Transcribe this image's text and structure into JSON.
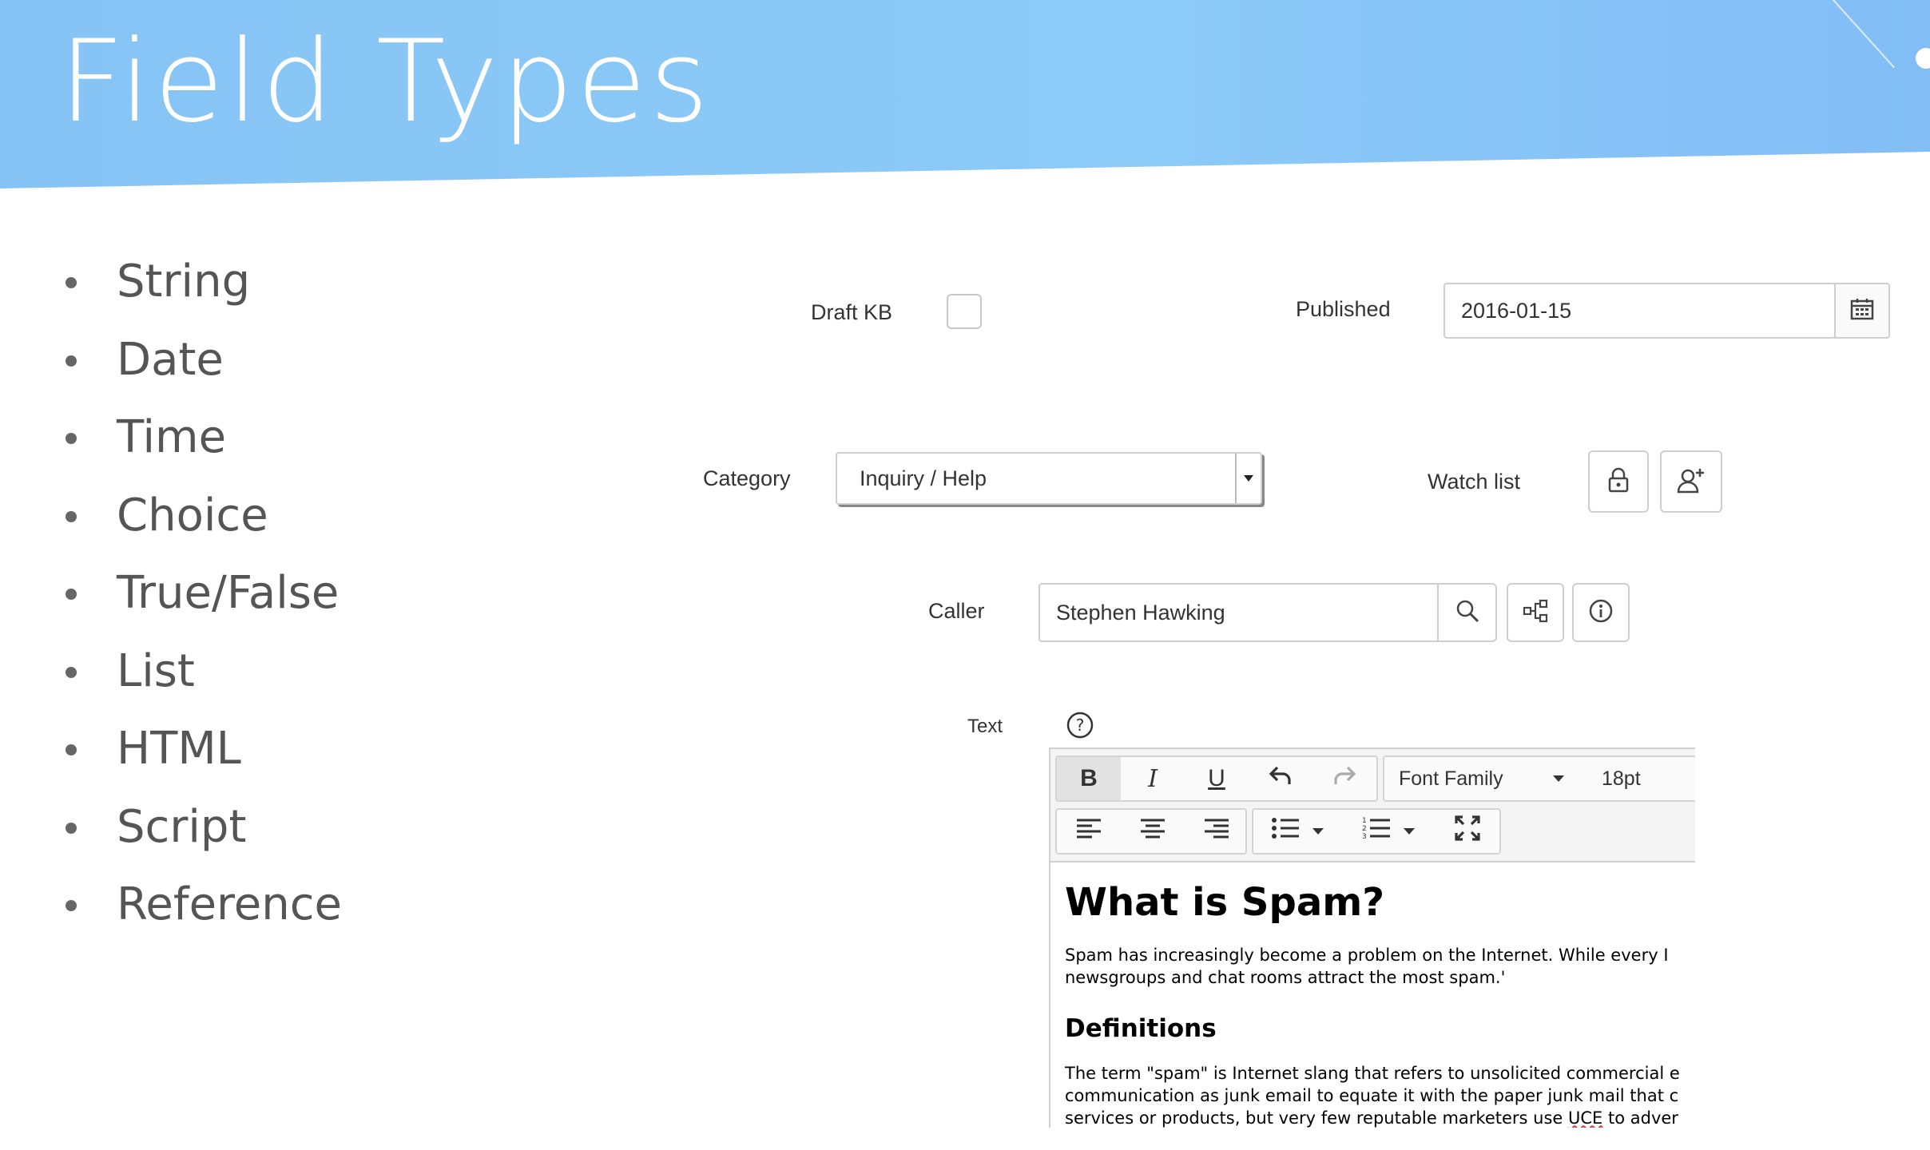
{
  "slide": {
    "title": "Field Types",
    "bullets": [
      "String",
      "Date",
      "Time",
      "Choice",
      "True/False",
      "List",
      "HTML",
      "Script",
      "Reference"
    ]
  },
  "form": {
    "draft_kb": {
      "label": "Draft KB",
      "checked": false
    },
    "published": {
      "label": "Published",
      "value": "2016-01-15",
      "icon": "calendar-icon"
    },
    "category": {
      "label": "Category",
      "value": "Inquiry / Help"
    },
    "watch_list": {
      "label": "Watch list",
      "icons": [
        "lock-icon",
        "add-user-icon"
      ]
    },
    "caller": {
      "label": "Caller",
      "value": "Stephen Hawking",
      "icons": [
        "search-icon",
        "hierarchy-icon",
        "info-icon"
      ]
    },
    "text": {
      "label": "Text",
      "help_icon": "help-icon"
    }
  },
  "editor": {
    "toolbar": {
      "bold": "B",
      "italic": "I",
      "underline": "U",
      "font_family": "Font Family",
      "font_size": "18pt"
    },
    "content": {
      "heading": "What is Spam?",
      "paragraph1_line1": "Spam has increasingly become a problem on the Internet. While every I",
      "paragraph1_line2": "newsgroups and chat rooms attract the most spam.'",
      "subheading": "Definitions",
      "paragraph2_line1": "The term \"spam\" is Internet slang that refers to unsolicited commercial e",
      "paragraph2_line2": "communication as junk email to equate it with the paper junk mail that c",
      "paragraph2_line3_a": "services or products, but very few reputable marketers use ",
      "paragraph2_line3_b": "UCE",
      "paragraph2_line3_c": " to adver"
    }
  },
  "colors": {
    "banner": "#8ccaf8",
    "title": "#ffffff"
  }
}
